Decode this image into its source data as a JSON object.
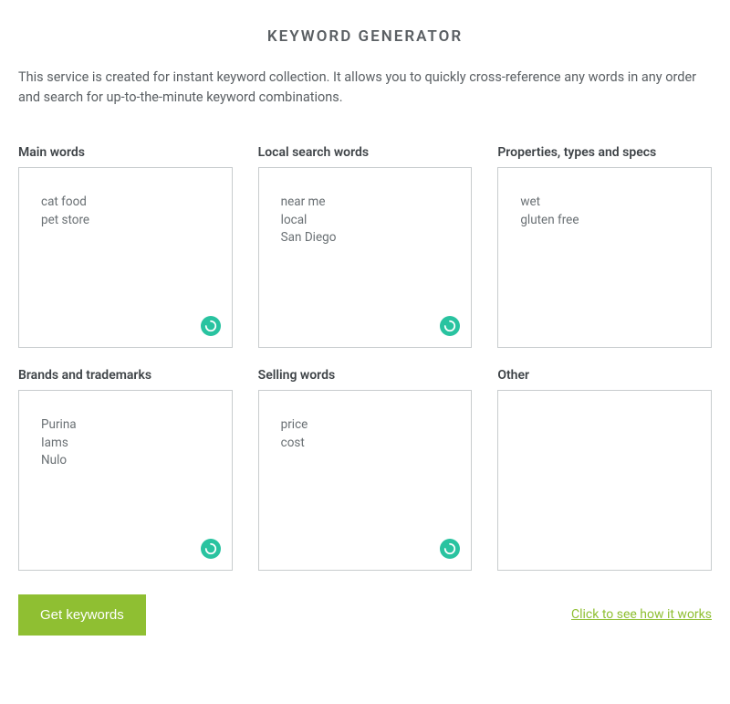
{
  "title": "KEYWORD GENERATOR",
  "intro": "This service is created for instant keyword collection. It allows you to quickly cross-reference any words in any order and search for up-to-the-minute keyword combinations.",
  "boxes": {
    "main": {
      "label": "Main words",
      "value": "cat food\npet store"
    },
    "local": {
      "label": "Local search words",
      "value": "near me\nlocal\nSan Diego"
    },
    "props": {
      "label": "Properties, types and specs",
      "value": "wet\ngluten free"
    },
    "brands": {
      "label": "Brands and trademarks",
      "value": "Purina\nIams\nNulo"
    },
    "selling": {
      "label": "Selling words",
      "value": "price\ncost"
    },
    "other": {
      "label": "Other",
      "value": ""
    }
  },
  "footer": {
    "button": "Get keywords",
    "link": "Click to see how it works"
  },
  "badge_icon_name": "spinner-icon"
}
